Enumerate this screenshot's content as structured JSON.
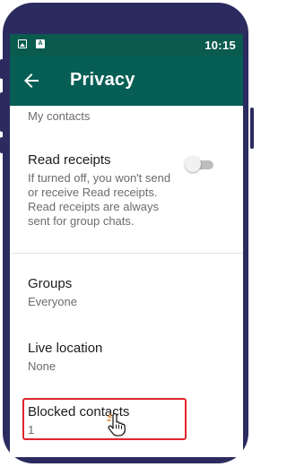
{
  "status_bar": {
    "time": "10:15",
    "icons": [
      "image-notification-icon",
      "app-notification-icon"
    ],
    "app_icon_letter": "A"
  },
  "app_bar": {
    "title": "Privacy",
    "back_icon": "arrow-left-icon"
  },
  "settings": {
    "profile_photo_value": "My contacts",
    "read_receipts": {
      "label": "Read receipts",
      "description": [
        "If turned off, you won't send",
        "or receive Read receipts.",
        "Read receipts are always",
        "sent for group chats."
      ],
      "enabled": false
    },
    "groups": {
      "label": "Groups",
      "value": "Everyone"
    },
    "live_location": {
      "label": "Live location",
      "value": "None"
    },
    "blocked_contacts": {
      "label": "Blocked contacts",
      "value": "1"
    }
  },
  "colors": {
    "status_bar": "#0b5a4e",
    "app_bar": "#075e54",
    "phone_frame": "#2b2b5f",
    "highlight": "#e0242d"
  }
}
